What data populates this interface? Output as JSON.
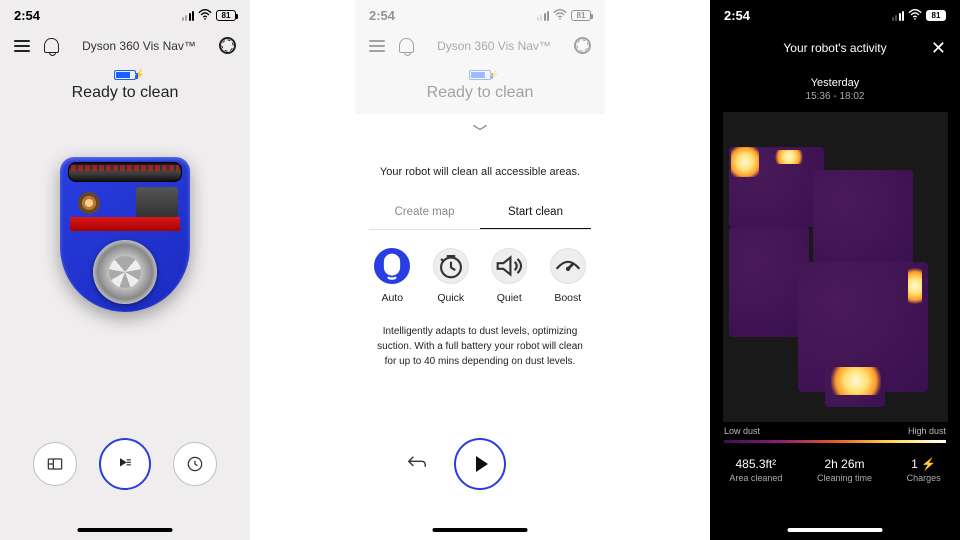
{
  "status": {
    "time": "2:54",
    "battery": "81"
  },
  "pane1": {
    "deviceTitle": "Dyson 360 Vis Nav™",
    "readyText": "Ready to clean"
  },
  "pane2": {
    "deviceTitle": "Dyson 360 Vis Nav™",
    "readyText": "Ready to clean",
    "description": "Your robot will clean all accessible areas.",
    "tabs": {
      "createMap": "Create map",
      "startClean": "Start clean"
    },
    "modes": {
      "auto": "Auto",
      "quick": "Quick",
      "quiet": "Quiet",
      "boost": "Boost"
    },
    "modeDescription": "Intelligently adapts to dust levels, optimizing suction. With a full battery your robot will clean for up to 40 mins depending on dust levels."
  },
  "pane3": {
    "title": "Your robot's activity",
    "dayLabel": "Yesterday",
    "timeRange": "15:36 - 18:02",
    "legend": {
      "low": "Low dust",
      "high": "High dust"
    },
    "stats": {
      "area": {
        "value": "485.3ft²",
        "label": "Area cleaned"
      },
      "time": {
        "value": "2h 26m",
        "label": "Cleaning time"
      },
      "charges": {
        "value": "1 ⚡",
        "label": "Charges"
      }
    }
  }
}
